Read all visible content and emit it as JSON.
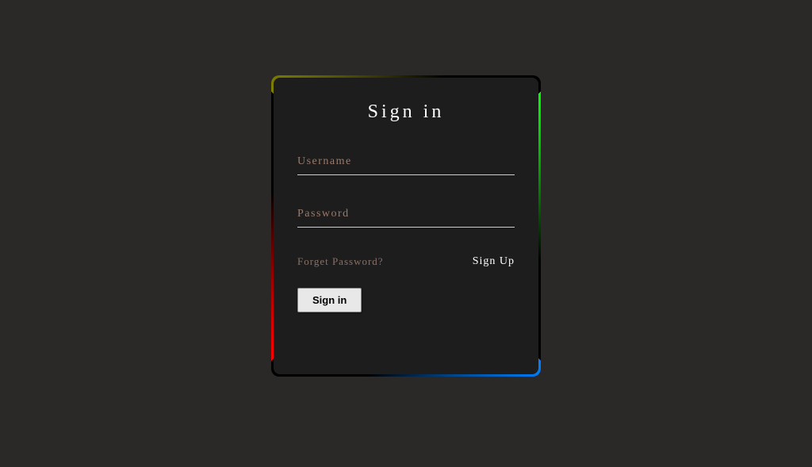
{
  "form": {
    "title": "Sign in",
    "username": {
      "label": "Username",
      "value": ""
    },
    "password": {
      "label": "Password",
      "value": ""
    },
    "forgot_label": "Forget Password?",
    "signup_label": "Sign Up",
    "signin_button_label": "Sign in"
  }
}
